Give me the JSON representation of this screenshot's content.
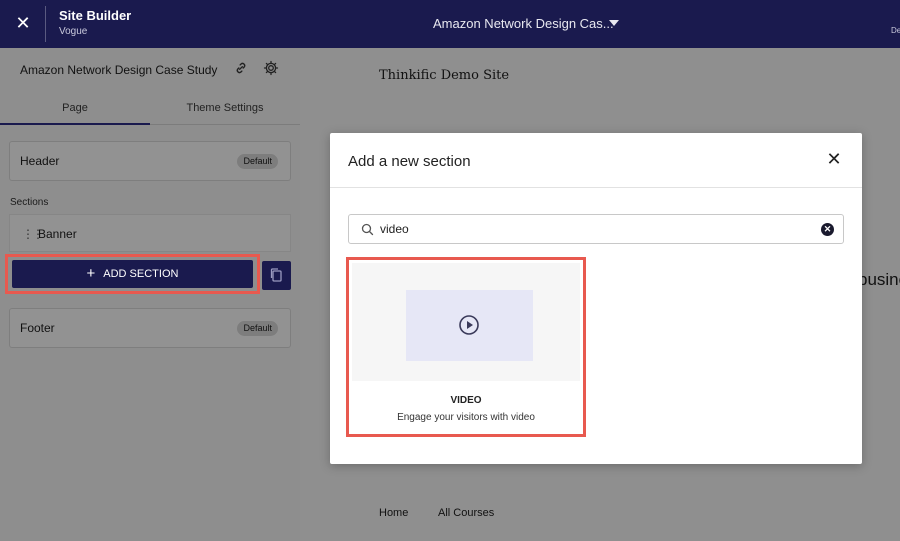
{
  "topbar": {
    "title": "Site Builder",
    "subtitle": "Vogue",
    "course_select": "Amazon Network Design Cas...",
    "edge_text": "De"
  },
  "sidebar": {
    "panel_title": "Amazon Network Design Case Study",
    "tabs": [
      {
        "label": "Page",
        "active": true
      },
      {
        "label": "Theme Settings",
        "active": false
      }
    ],
    "header_card": {
      "label": "Header",
      "badge": "Default"
    },
    "sections_label": "Sections",
    "sections": [
      {
        "label": "Banner"
      }
    ],
    "add_section_label": "ADD SECTION",
    "footer_card": {
      "label": "Footer",
      "badge": "Default"
    }
  },
  "preview": {
    "site_title": "Thinkific Demo Site",
    "partial_text": "busines",
    "footer_nav": [
      "Home",
      "All Courses"
    ]
  },
  "modal": {
    "title": "Add a new section",
    "search": {
      "value": "video",
      "placeholder": ""
    },
    "options": [
      {
        "name": "VIDEO",
        "description": "Engage your visitors with video"
      }
    ]
  },
  "colors": {
    "brand_navy": "#1a1a4e",
    "highlight_red": "#e8594f",
    "thumb_lavender": "#e6e7f6"
  },
  "icons": [
    "close-icon",
    "chevron-down-icon",
    "link-icon",
    "gear-icon",
    "drag-handle-icon",
    "plus-icon",
    "copy-icon",
    "search-icon",
    "clear-icon",
    "play-icon"
  ]
}
